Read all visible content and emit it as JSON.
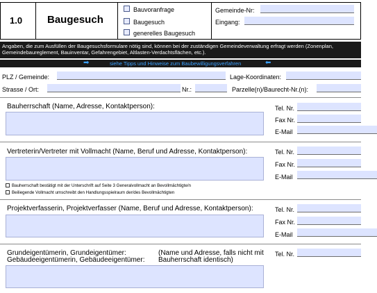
{
  "header": {
    "number": "1.0",
    "title": "Baugesuch",
    "options": [
      "Bauvoranfrage",
      "Baugesuch",
      "generelles Baugesuch"
    ],
    "gemeinde_label": "Gemeinde-Nr:",
    "eingang_label": "Eingang:"
  },
  "info": {
    "text": "Angaben, die zum Ausfüllen der Baugesuchsformulare nötig sind, können bei der zuständigen Gemeindeverwaltung erfragt werden (Zonenplan, Gemeindebaureglement, Bauinventar, Gefahrengebiet, Altlasten-Verdachtsflächen, etc.).",
    "tips_link": "siehe Tipps und Hinweise zum Baubewilligungsverfahren"
  },
  "location": {
    "plz_label": "PLZ / Gemeinde:",
    "strasse_label": "Strasse / Ort:",
    "nr_label": "Nr.:",
    "koordinaten_label": "Lage-Koordinaten:",
    "parzelle_label": "Parzelle(n)/Baurecht-Nr.(n):"
  },
  "contact_labels": {
    "tel": "Tel. Nr.",
    "fax": "Fax Nr.",
    "email": "E-Mail"
  },
  "sections": {
    "bauherrschaft": "Bauherrschaft (Name, Adresse, Kontaktperson):",
    "vertreter": "Vertreterin/Vertreter mit  Vollmacht (Name, Beruf und Adresse, Kontaktperson):",
    "vollmacht_1": "Bauherrschaft bestätigt mit der Unterschrift auf Seite 3 Generalvollmacht an Bevollmächtigte/n",
    "vollmacht_2": "Beiliegende Vollmacht umschreibt den Handlungsspielraum der/des Bevollmächtigten",
    "projektverfasser": "Projektverfasserin, Projektverfasser (Name, Beruf und Adresse, Kontaktperson):",
    "grund_line1": "Grundeigentümerin, Grundeigentümer:",
    "grund_line2": "Gebäudeeigentümerin, Gebäudeeigentümer:",
    "grund_note1": "(Name und Adresse, falls nicht mit",
    "grund_note2": "Bauherrschaft identisch)"
  }
}
